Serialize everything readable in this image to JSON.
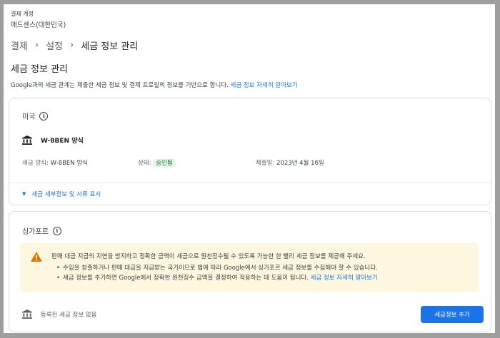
{
  "account": {
    "label": "결제 계정",
    "name": "애드센스(대한민국)"
  },
  "breadcrumb": {
    "items": [
      "결제",
      "설정"
    ],
    "current": "세금 정보 관리"
  },
  "page_title": "세금 정보 관리",
  "intro": {
    "text": "Google과의 세금 관계는 제출한 세금 정보 및 결제 프로필의 정보를 기반으로 합니다.",
    "link": "세금 정보 자세히 알아보기"
  },
  "us": {
    "country": "미국",
    "form_name": "W-8BEN 양식",
    "tax_form_label": "세금 양식:",
    "tax_form_value": "W-8BEN 양식",
    "status_label": "상태:",
    "status_value": "승인됨",
    "submitted_label": "제출일:",
    "submitted_value": "2023년 4월 16일",
    "expand_label": "세금 세부정보 및 서류 표시"
  },
  "sg": {
    "country": "싱가포르",
    "warning_main": "판매 대금 지급의 지연을 방지하고 정확한 금액이 세금으로 원천징수될 수 있도록 가능한 한 빨리 세금 정보를 제공해 주세요.",
    "bullet1": "수입을 창출하거나 판매 대금을 지급받는 국가이므로 법에 따라 Google에서 싱가포르 세금 정보를 수집해야 할 수 있습니다.",
    "bullet2": "세금 정보를 추가하면 Google에서 정확한 원천징수 금액을 결정하여 적용하는 데 도움이 됩니다.",
    "bullet2_link": "세금 정보 자세히 알아보기",
    "no_info": "등록된 세금 정보 없음",
    "add_button": "세금정보 추가"
  },
  "colors": {
    "accent": "#1a73e8",
    "approved_bg": "#e6f4ea",
    "approved_text": "#137333",
    "warning_bg": "#fef7e0",
    "warning_icon": "#e37400"
  }
}
